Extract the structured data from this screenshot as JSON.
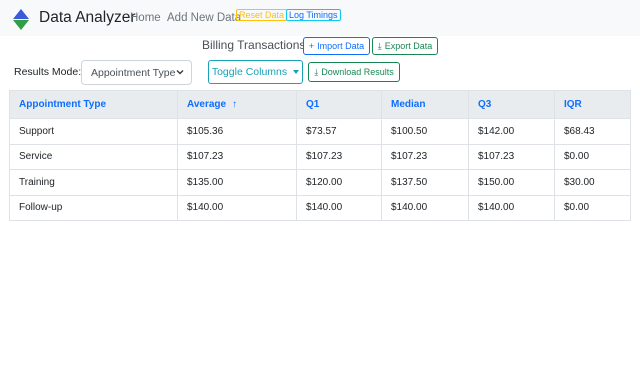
{
  "nav": {
    "brand": "Data Analyzer",
    "home": "Home",
    "add_new_data": "Add New Data",
    "reset_data": "Reset Data",
    "log_timings": "Log Timings"
  },
  "page": {
    "title": "Billing Transactions",
    "import_label": "Import Data",
    "export_label": "Export Data",
    "import_icon": "+",
    "export_icon": "⤓"
  },
  "controls": {
    "results_mode_label": "Results Mode:",
    "results_mode_value": "Appointment Type",
    "toggle_columns_label": "Toggle Columns",
    "download_label": "Download Results",
    "download_icon": "⤓"
  },
  "table": {
    "headers": [
      "Appointment Type",
      "Average",
      "Q1",
      "Median",
      "Q3",
      "IQR"
    ],
    "sort_indicator": "↑",
    "rows": [
      [
        "Support",
        "$105.36",
        "$73.57",
        "$100.50",
        "$142.00",
        "$68.43"
      ],
      [
        "Service",
        "$107.23",
        "$107.23",
        "$107.23",
        "$107.23",
        "$0.00"
      ],
      [
        "Training",
        "$135.00",
        "$120.00",
        "$137.50",
        "$150.00",
        "$30.00"
      ],
      [
        "Follow-up",
        "$140.00",
        "$140.00",
        "$140.00",
        "$140.00",
        "$0.00"
      ]
    ]
  },
  "colors": {
    "primary": "#0d6efd",
    "success": "#198754",
    "warning": "#ffc107",
    "info": "#17a2b8",
    "logo_blue": "#3b5bdb",
    "logo_green": "#2f9e44"
  }
}
